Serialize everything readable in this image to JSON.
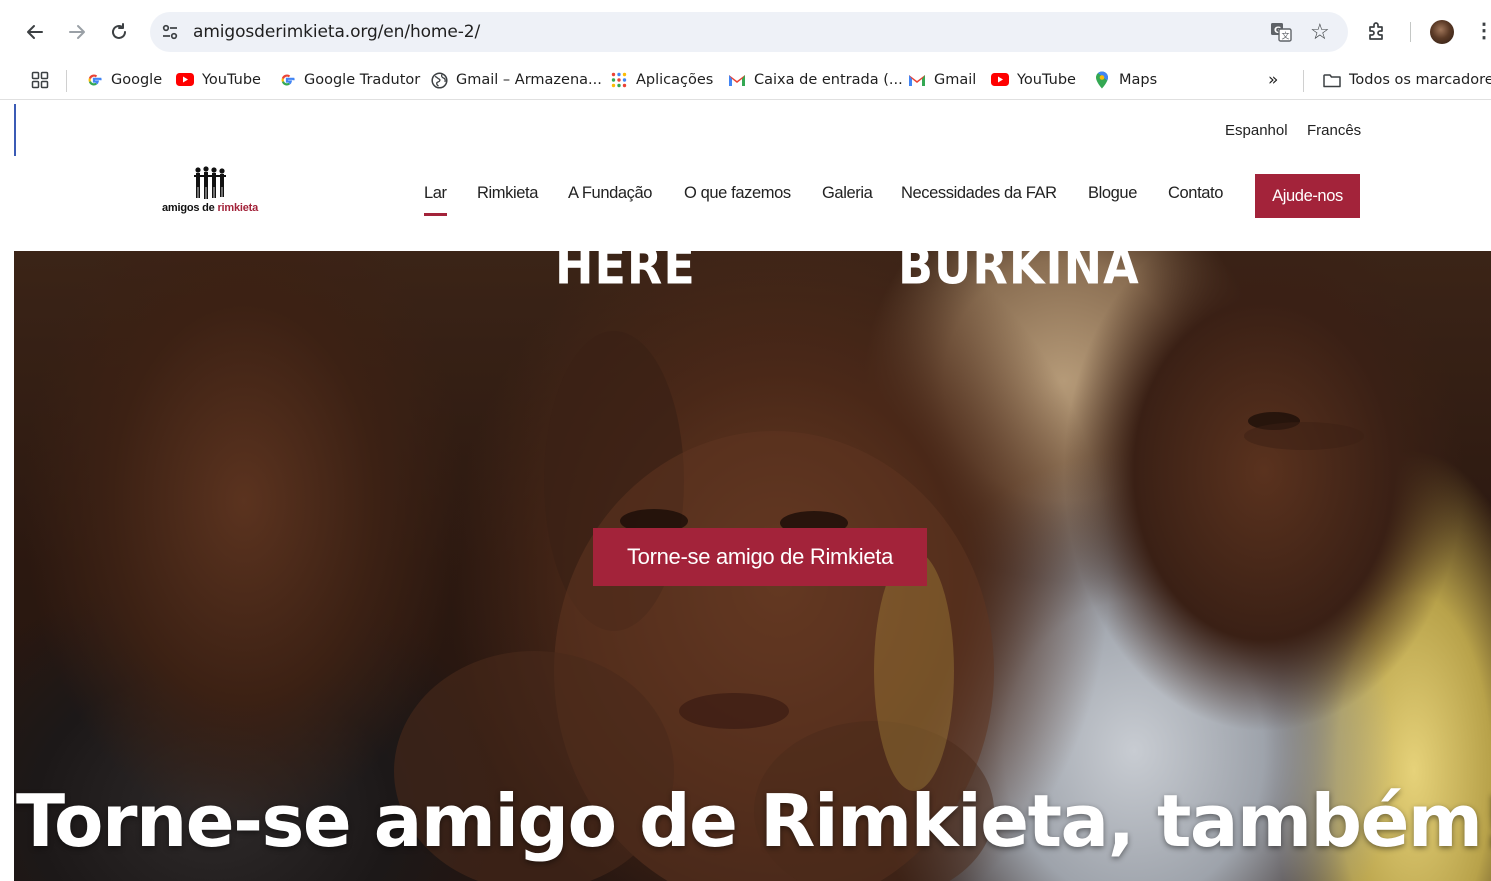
{
  "browser": {
    "url": "amigosderimkieta.org/en/home-2/",
    "bookmarks": [
      {
        "label": "Google",
        "icon": "google-icon"
      },
      {
        "label": "YouTube",
        "icon": "youtube-icon"
      },
      {
        "label": "Google Tradutor",
        "icon": "google-icon"
      },
      {
        "label": "Gmail – Armazena...",
        "icon": "globe-icon"
      },
      {
        "label": "Aplicações",
        "icon": "apps-grid-icon"
      },
      {
        "label": "Caixa de entrada (...",
        "icon": "gmail-icon"
      },
      {
        "label": "Gmail",
        "icon": "gmail-icon"
      },
      {
        "label": "YouTube",
        "icon": "youtube-icon"
      },
      {
        "label": "Maps",
        "icon": "maps-pin-icon"
      }
    ],
    "overflow_label": "»",
    "all_bookmarks_label": "Todos os marcadores"
  },
  "site": {
    "languages": [
      "Espanhol",
      "Francês"
    ],
    "logo": {
      "text_black": "amigos de ",
      "text_red": "rimkieta"
    },
    "menu": [
      "Lar",
      "Rimkieta",
      "A Fundação",
      "O que fazemos",
      "Galeria",
      "Necessidades da FAR",
      "Blogue",
      "Contato"
    ],
    "active_menu": "Lar",
    "nav_cta": "Ajude-nos",
    "hero": {
      "word_left": "HERE",
      "word_right": "BURKINA",
      "cta": "Torne-se amigo de Rimkieta",
      "title": "Torne-se amigo de Rimkieta, também!"
    }
  },
  "colors": {
    "accent": "#a3233a",
    "omnibox": "#eef1f7"
  }
}
